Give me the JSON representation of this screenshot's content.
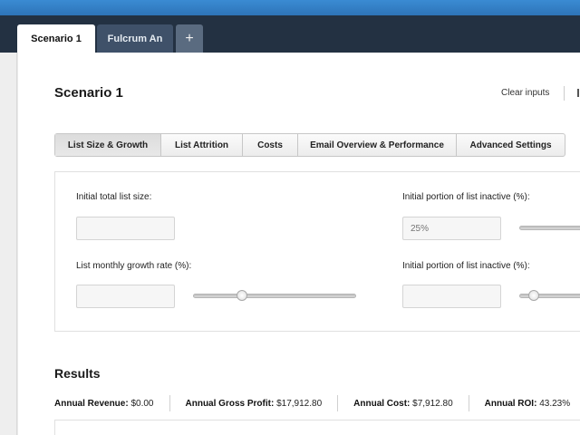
{
  "tabs": {
    "active": "Scenario 1",
    "second": "Fulcrum An",
    "add_label": "+"
  },
  "page": {
    "title": "Scenario 1",
    "clear_inputs": "Clear inputs"
  },
  "subtabs": [
    {
      "label": "List Size & Growth",
      "active": true
    },
    {
      "label": "List Attrition",
      "active": false
    },
    {
      "label": "Costs",
      "active": false
    },
    {
      "label": "Email Overview & Performance",
      "active": false
    },
    {
      "label": "Advanced Settings",
      "active": false
    }
  ],
  "form": {
    "initial_list_size": {
      "label": "Initial total list size:",
      "value": "",
      "placeholder": ""
    },
    "inactive_1": {
      "label": "Initial portion of list inactive (%):",
      "value": "",
      "placeholder": "25%"
    },
    "growth_rate": {
      "label": "List monthly growth rate (%):",
      "value": "",
      "placeholder": "",
      "slider_fraction": 0.3
    },
    "inactive_2": {
      "label": "Initial portion of list inactive (%):",
      "value": "",
      "placeholder": ""
    }
  },
  "results": {
    "title": "Results",
    "metrics": [
      {
        "label": "Annual Revenue:",
        "value": "$0.00"
      },
      {
        "label": "Annual Gross Profit:",
        "value": "$17,912.80"
      },
      {
        "label": "Annual Cost:",
        "value": "$7,912.80"
      },
      {
        "label": "Annual ROI:",
        "value": "43.23%"
      }
    ]
  },
  "colors": {
    "topbar": "#2e74b8",
    "tabbar": "#233142",
    "active_tab": "#ffffff",
    "inactive_tab": "#3f5169"
  }
}
